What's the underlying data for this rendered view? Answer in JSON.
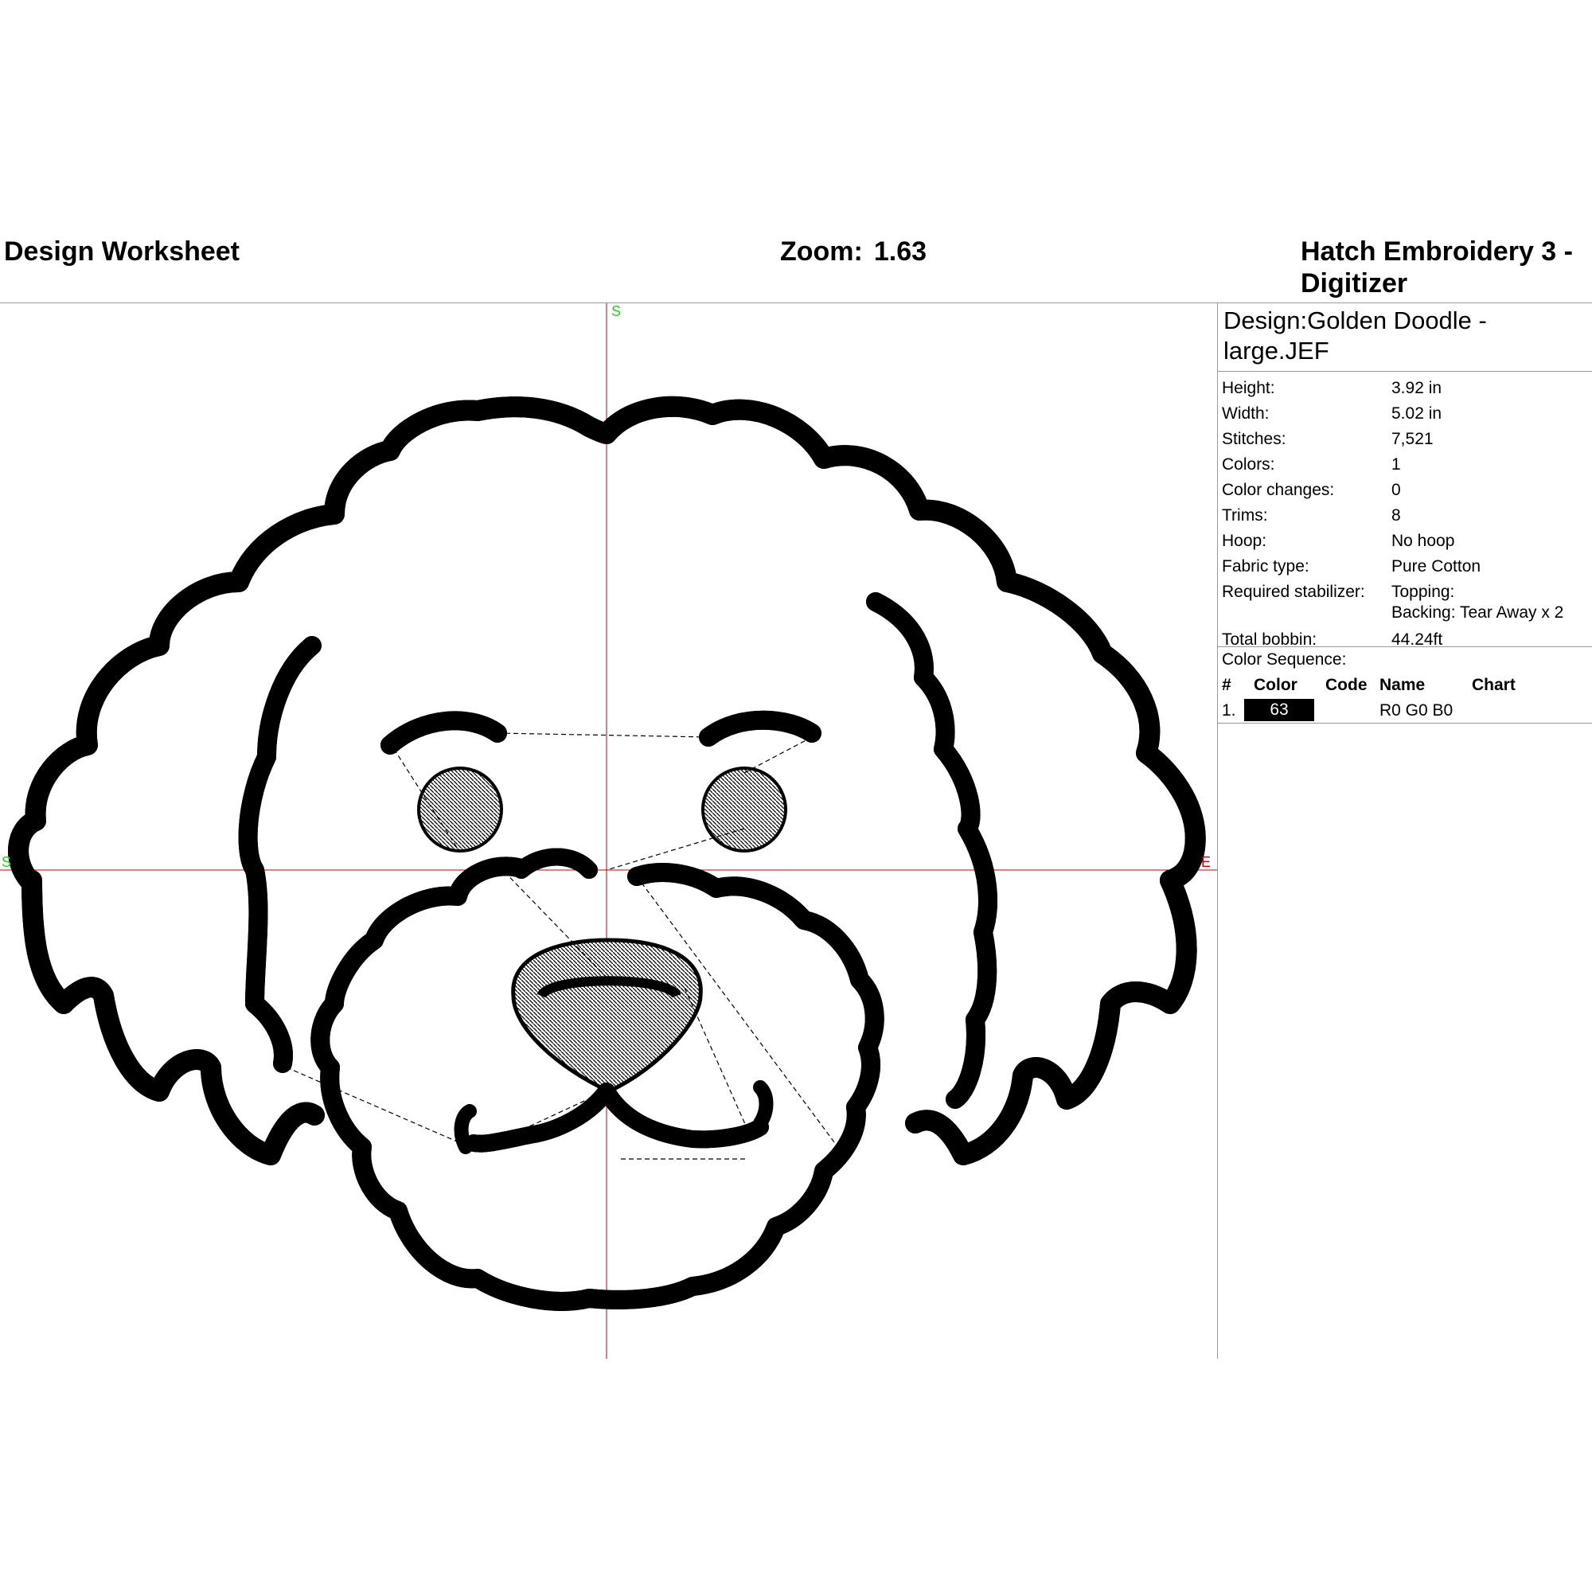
{
  "header": {
    "title": "Design Worksheet",
    "zoom_label": "Zoom:",
    "zoom_value": "1.63",
    "app_name": "Hatch Embroidery 3 - Digitizer"
  },
  "canvas": {
    "start_marker_top": "S",
    "start_marker_left": "S",
    "end_marker": "E",
    "stitch_color": "#000000",
    "axis_color": "#c00000",
    "start_color": "#22cc22"
  },
  "design": {
    "name": "Design:Golden Doodle - large.JEF",
    "stats": [
      {
        "label": "Height:",
        "value": "3.92 in"
      },
      {
        "label": "Width:",
        "value": "5.02 in"
      },
      {
        "label": "Stitches:",
        "value": "7,521"
      },
      {
        "label": "Colors:",
        "value": "1"
      },
      {
        "label": "Color changes:",
        "value": "0"
      },
      {
        "label": "Trims:",
        "value": "8"
      },
      {
        "label": "Hoop:",
        "value": "No hoop"
      },
      {
        "label": "Fabric type:",
        "value": "Pure Cotton"
      },
      {
        "label": "Required stabilizer:",
        "value": "Topping:",
        "value2": "Backing: Tear Away x 2"
      },
      {
        "label": "Total bobbin:",
        "value": "44.24ft"
      }
    ]
  },
  "color_sequence": {
    "title": "Color Sequence:",
    "columns": [
      "#",
      "Color",
      "Code",
      "Name",
      "Chart"
    ],
    "rows": [
      {
        "num": "1.",
        "color": "63",
        "code": "",
        "name": "R0 G0 B0",
        "chart": ""
      }
    ]
  }
}
